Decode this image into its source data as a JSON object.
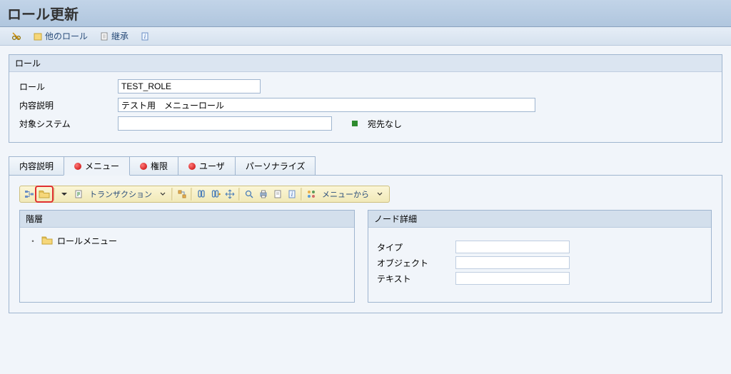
{
  "header": {
    "title": "ロール更新"
  },
  "toolbar": {
    "other_role_label": "他のロール",
    "inherit_label": "継承"
  },
  "role_group": {
    "title": "ロール",
    "role_label": "ロール",
    "role_value": "TEST_ROLE",
    "desc_label": "内容説明",
    "desc_value": "テスト用　メニューロール",
    "target_label": "対象システム",
    "target_value": "",
    "target_status": "宛先なし"
  },
  "tabs": {
    "active": 1,
    "items": [
      {
        "label": "内容説明",
        "dot": false
      },
      {
        "label": "メニュー",
        "dot": true
      },
      {
        "label": "権限",
        "dot": true
      },
      {
        "label": "ユーザ",
        "dot": true
      },
      {
        "label": "パーソナライズ",
        "dot": false
      }
    ]
  },
  "menu_toolbar": {
    "transaction_label": "トランザクション",
    "from_menu_label": "メニューから"
  },
  "hierarchy": {
    "title": "階層",
    "root_label": "ロールメニュー"
  },
  "node_detail": {
    "title": "ノード詳細",
    "type_label": "タイプ",
    "type_value": "",
    "object_label": "オブジェクト",
    "object_value": "",
    "text_label": "テキスト",
    "text_value": ""
  }
}
